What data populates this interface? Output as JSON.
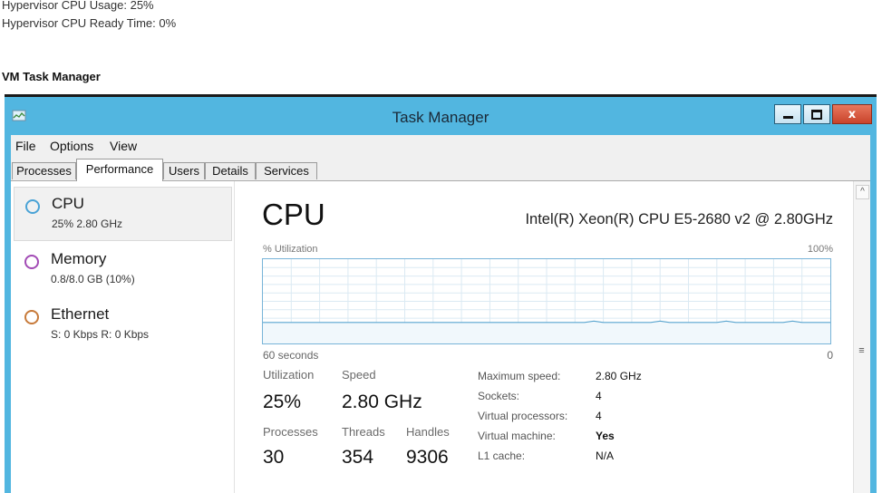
{
  "info": {
    "hypervisor_usage": "Hypervisor CPU Usage: 25%",
    "hypervisor_ready": "Hypervisor CPU Ready Time: 0%"
  },
  "section_title": "VM Task Manager",
  "window": {
    "title": "Task Manager",
    "close_glyph": "x",
    "accent_color": "#52b6e0"
  },
  "menu": [
    "File",
    "Options",
    "View"
  ],
  "tabs": [
    {
      "label": "Processes"
    },
    {
      "label": "Performance",
      "active": true
    },
    {
      "label": "Users"
    },
    {
      "label": "Details"
    },
    {
      "label": "Services"
    }
  ],
  "sidebar": [
    {
      "title": "CPU",
      "subtitle": "25% 2.80 GHz",
      "color": "#4aa3d6",
      "active": true
    },
    {
      "title": "Memory",
      "subtitle": "0.8/8.0 GB (10%)",
      "color": "#a24bb5"
    },
    {
      "title": "Ethernet",
      "subtitle": "S: 0 Kbps R: 0 Kbps",
      "color": "#c77a3a"
    }
  ],
  "main": {
    "heading": "CPU",
    "model": "Intel(R) Xeon(R) CPU E5-2680 v2 @ 2.80GHz",
    "graph_label_left": "% Utilization",
    "graph_label_right": "100%",
    "axis_left": "60 seconds",
    "axis_right": "0",
    "graph_utilization_pct": 25,
    "stats": {
      "utilization_label": "Utilization",
      "utilization": "25%",
      "speed_label": "Speed",
      "speed": "2.80 GHz",
      "processes_label": "Processes",
      "processes": "30",
      "threads_label": "Threads",
      "threads": "354",
      "handles_label": "Handles",
      "handles": "9306"
    },
    "specs": [
      {
        "key": "Maximum speed:",
        "value": "2.80 GHz"
      },
      {
        "key": "Sockets:",
        "value": "4"
      },
      {
        "key": "Virtual processors:",
        "value": "4"
      },
      {
        "key": "Virtual machine:",
        "value": "Yes"
      },
      {
        "key": "L1 cache:",
        "value": "N/A"
      }
    ]
  },
  "scrollbar": {
    "up_glyph": "^",
    "grip_glyph": "≡"
  }
}
